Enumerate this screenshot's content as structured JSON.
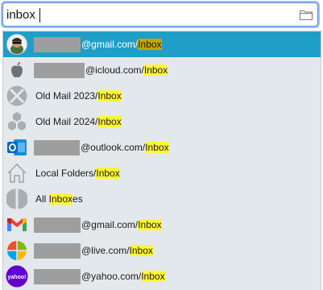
{
  "search": {
    "value": "inbox",
    "folder_icon": "folder-icon"
  },
  "colors": {
    "selected_row": "#1f9fc7",
    "highlight": "#fff53a",
    "selected_highlight": "#c9a400"
  },
  "results": [
    {
      "icon": "avatar-icon",
      "redacted": true,
      "prefix": "@gmail.com/",
      "match": "Inbox",
      "suffix": ""
    },
    {
      "icon": "apple-icon",
      "redacted": true,
      "prefix": "@icloud.com/",
      "match": "Inbox",
      "suffix": ""
    },
    {
      "icon": "x-circle-icon",
      "redacted": false,
      "prefix": "Old Mail 2023/",
      "match": "Inbox",
      "suffix": ""
    },
    {
      "icon": "hexagon-cluster-icon",
      "redacted": false,
      "prefix": "Old Mail 2024/",
      "match": "Inbox",
      "suffix": ""
    },
    {
      "icon": "outlook-icon",
      "redacted": true,
      "prefix": "@outlook.com/",
      "match": "Inbox",
      "suffix": ""
    },
    {
      "icon": "house-icon",
      "redacted": false,
      "prefix": "Local Folders/",
      "match": "Inbox",
      "suffix": ""
    },
    {
      "icon": "half-circle-icon",
      "redacted": false,
      "prefix": "All ",
      "match": "Inbox",
      "suffix": "es"
    },
    {
      "icon": "gmail-icon",
      "redacted": true,
      "prefix": "@gmail.com/",
      "match": "Inbox",
      "suffix": ""
    },
    {
      "icon": "microsoft-icon",
      "redacted": true,
      "prefix": "@live.com/",
      "match": "Inbox",
      "suffix": ""
    },
    {
      "icon": "yahoo-icon",
      "redacted": true,
      "prefix": "@yahoo.com/",
      "match": "Inbox",
      "suffix": "",
      "icon_text": "yahoo!"
    }
  ]
}
